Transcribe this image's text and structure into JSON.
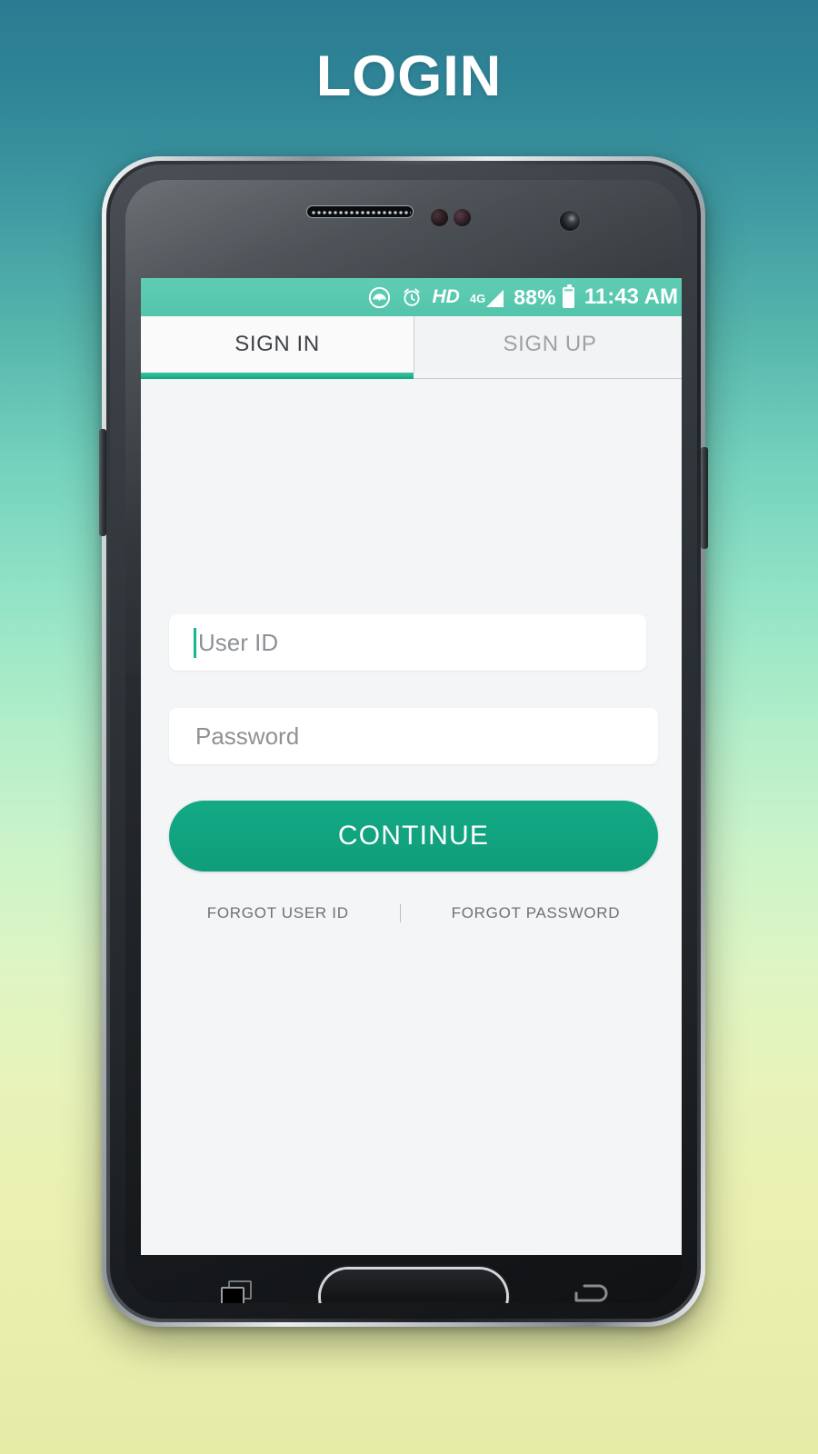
{
  "page": {
    "heading": "LOGIN",
    "background_gradient_top": "#2b7c92",
    "background_gradient_bottom": "#e5eca6"
  },
  "device": {
    "earpiece_icon": "speaker-grille-icon",
    "proximity_sensor_icon": "proximity-sensor-icon",
    "light_sensor_icon": "light-sensor-icon",
    "front_camera_icon": "front-camera-icon",
    "volume_button": "volume-rocker",
    "power_button": "power-button"
  },
  "status_bar": {
    "background_color": "#56c8ad",
    "hotspot_icon": "hotspot-icon",
    "alarm_icon": "alarm-clock-icon",
    "hd_label": "HD",
    "network_label": "4G",
    "signal_icon": "signal-bars-icon",
    "battery_percent": "88%",
    "battery_icon": "battery-icon",
    "time": "11:43 AM"
  },
  "tabs": {
    "active_index": 0,
    "indicator_color": "#12a67f",
    "items": [
      {
        "label": "SIGN IN"
      },
      {
        "label": "SIGN UP"
      }
    ]
  },
  "form": {
    "user_id": {
      "placeholder": "User ID",
      "value": "",
      "focused": true,
      "caret_color": "#12b98c"
    },
    "password": {
      "placeholder": "Password",
      "value": "",
      "focused": false
    },
    "continue_label": "CONTINUE",
    "continue_color": "#11a37c",
    "forgot_user_id_label": "FORGOT USER ID",
    "forgot_password_label": "FORGOT PASSWORD",
    "separator": "|"
  },
  "navigation_bar": {
    "recents_icon": "recents-icon",
    "home_button": "home-button",
    "back_icon": "back-arrow-icon"
  }
}
